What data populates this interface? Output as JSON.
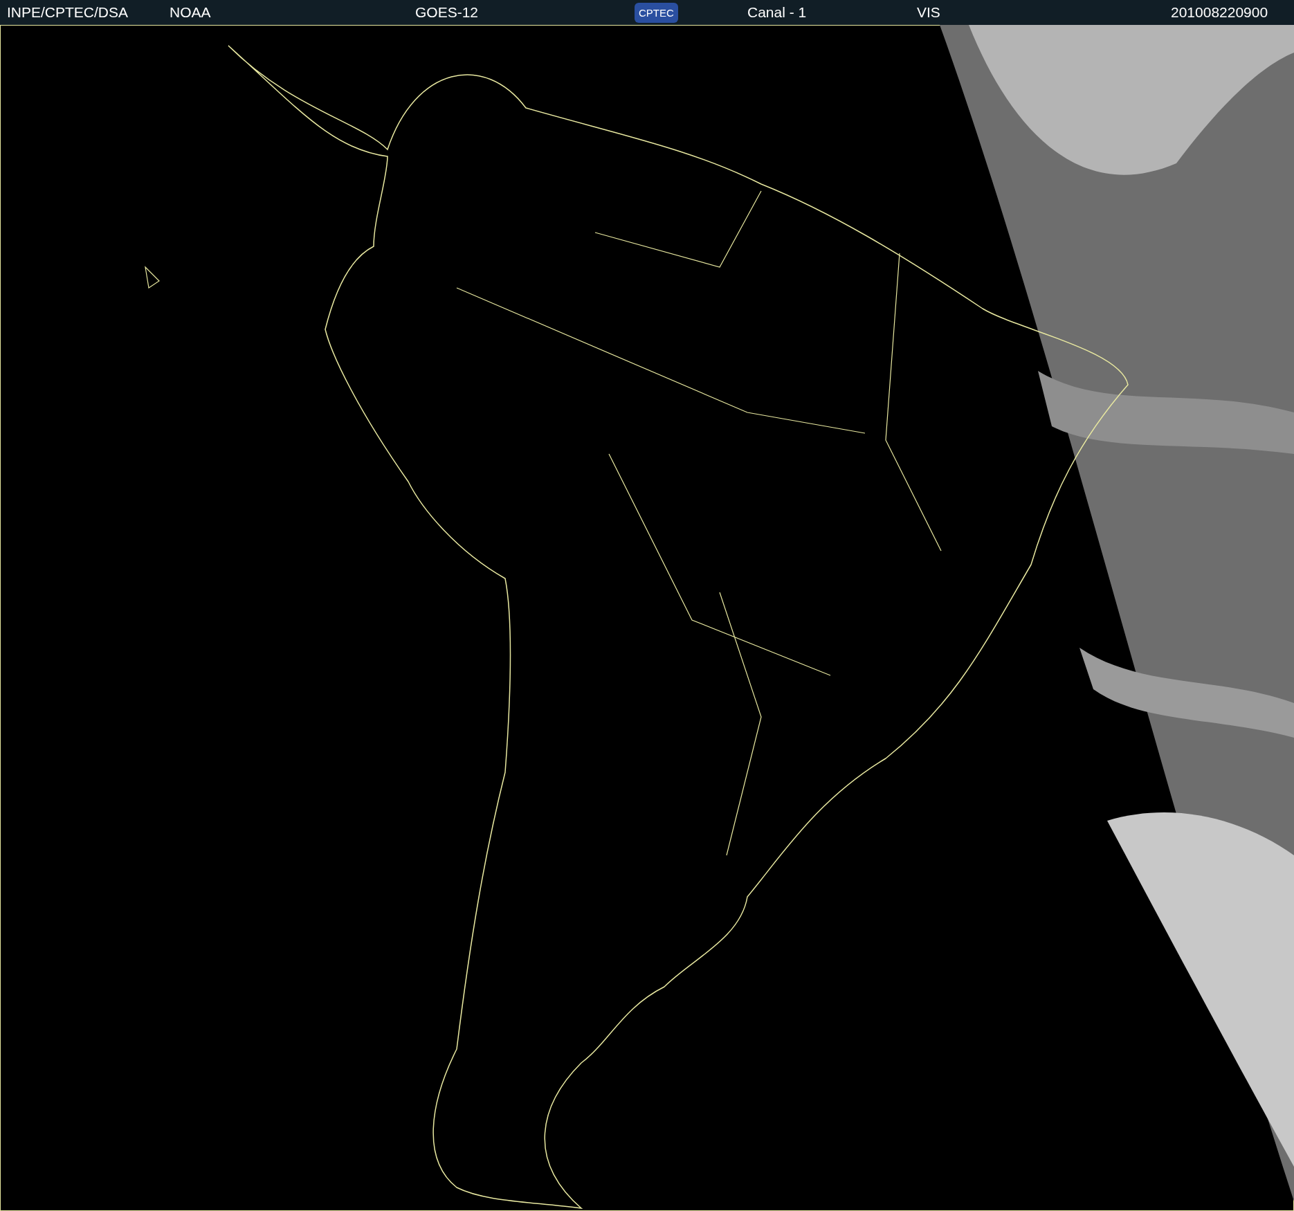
{
  "header": {
    "items": [
      {
        "kind": "text",
        "text": "INPE/CPTEC/DSA"
      },
      {
        "kind": "text",
        "text": "NOAA"
      },
      {
        "kind": "text",
        "text": "GOES-12"
      },
      {
        "kind": "logo",
        "text": "CPTEC"
      },
      {
        "kind": "text",
        "text": "Canal - 1"
      },
      {
        "kind": "text",
        "text": "VIS"
      },
      {
        "kind": "text",
        "text": "201008220900"
      }
    ]
  }
}
